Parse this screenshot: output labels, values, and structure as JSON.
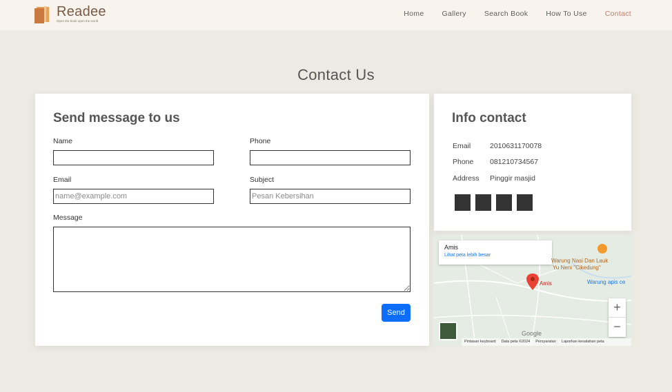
{
  "brand": {
    "name": "Readee",
    "tagline": "Open the book open the world"
  },
  "nav": {
    "items": [
      {
        "label": "Home"
      },
      {
        "label": "Gallery"
      },
      {
        "label": "Search Book"
      },
      {
        "label": "How To Use"
      },
      {
        "label": "Contact"
      }
    ]
  },
  "page": {
    "title": "Contact Us"
  },
  "form": {
    "title": "Send message to us",
    "name_label": "Name",
    "phone_label": "Phone",
    "email_label": "Email",
    "email_placeholder": "name@example.com",
    "subject_label": "Subject",
    "subject_placeholder": "Pesan Kebersihan",
    "message_label": "Message",
    "send_label": "Send"
  },
  "info": {
    "title": "Info contact",
    "rows": [
      {
        "key": "Email",
        "value": "2010631170078"
      },
      {
        "key": "Phone",
        "value": "081210734567"
      },
      {
        "key": "Address",
        "value": "Pinggir masjid"
      }
    ]
  },
  "map": {
    "place_name": "Amis",
    "view_larger": "Lihat peta lebih besar",
    "poi_warung_1": "Warung Nasi Dan Lauk",
    "poi_warung_2": "Yu Neni \"Cikedung\"",
    "poi_warung_3": "Warung apis ce",
    "pin_label": "Amis",
    "zoom_in": "+",
    "zoom_out": "−",
    "google": "Google",
    "footer": [
      "Pintasan keyboard",
      "Data peta ©2024",
      "Persyaratan",
      "Laporkan kesalahan peta"
    ]
  },
  "colors": {
    "accent": "#0d6efd",
    "nav_active": "#c27a6a",
    "background": "#ecebe3",
    "header_bg": "#f8f3ec"
  }
}
